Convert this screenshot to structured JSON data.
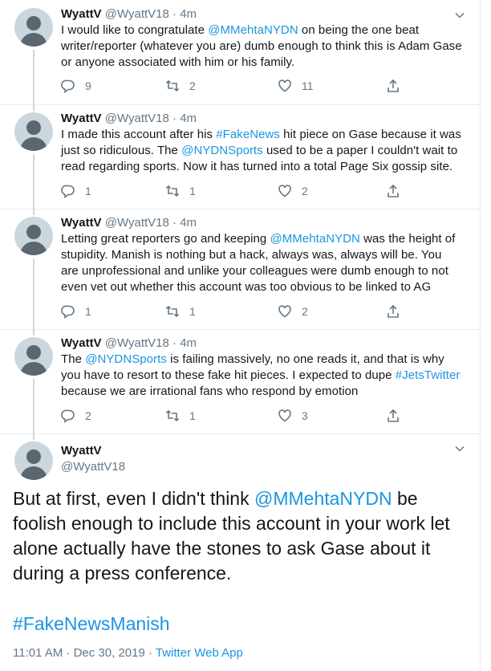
{
  "tweets": [
    {
      "name": "WyattV",
      "handle": "@WyattV18",
      "time": "4m",
      "text_parts": [
        "I would like to congratulate ",
        "@MMehtaNYDN",
        " on being the one beat writer/reporter (whatever you are) dumb enough to think this is Adam Gase or anyone associated with him or his family."
      ],
      "replies": "9",
      "retweets": "2",
      "likes": "11"
    },
    {
      "name": "WyattV",
      "handle": "@WyattV18",
      "time": "4m",
      "text_parts": [
        "I made this account after his ",
        "#FakeNews",
        " hit piece on Gase because it was just so ridiculous. The ",
        "@NYDNSports",
        " used to be a paper I couldn't wait to read regarding sports. Now it has turned into a total Page Six gossip site."
      ],
      "replies": "1",
      "retweets": "1",
      "likes": "2"
    },
    {
      "name": "WyattV",
      "handle": "@WyattV18",
      "time": "4m",
      "text_parts": [
        "Letting great reporters go and keeping ",
        "@MMehtaNYDN",
        " was the height of stupidity. Manish is nothing but a hack, always was, always will be. You are unprofessional and unlike your colleagues were dumb enough to not even vet out whether this account was too obvious to be linked to AG"
      ],
      "replies": "1",
      "retweets": "1",
      "likes": "2"
    },
    {
      "name": "WyattV",
      "handle": "@WyattV18",
      "time": "4m",
      "text_parts": [
        "The ",
        "@NYDNSports",
        " is failing massively, no one reads it, and that is why you have to resort to these fake hit pieces.  I expected to dupe ",
        "#JetsTwitter",
        " because we are irrational fans who respond by emotion"
      ],
      "replies": "2",
      "retweets": "1",
      "likes": "3"
    }
  ],
  "main": {
    "name": "WyattV",
    "handle": "@WyattV18",
    "text_parts": [
      "But at first, even I didn't think ",
      "@MMehtaNYDN",
      "  be foolish enough to include this account in your work let alone actually have the stones to ask Gase about it during a press conference."
    ],
    "hashtag": "#FakeNewsManish",
    "timestamp": "11:01 AM · Dec 30, 2019",
    "separator": " · ",
    "source": "Twitter Web App"
  },
  "sep": "·",
  "icons": {
    "reply": "reply-icon",
    "retweet": "retweet-icon",
    "like": "heart-icon",
    "share": "share-icon",
    "caret": "chevron-down-icon",
    "avatar": "default-avatar-icon"
  },
  "colors": {
    "link": "#1b95e0",
    "muted": "#657786",
    "border": "#e6ecf0",
    "avatar": "#ccd6dd"
  }
}
